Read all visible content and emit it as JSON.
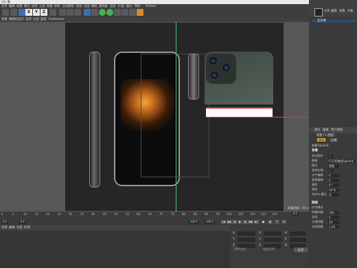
{
  "window": {
    "title": "(大) 墨"
  },
  "menubar": [
    "文件",
    "编辑",
    "创建",
    "模式",
    "选择",
    "工具",
    "网格",
    "体积",
    "运动图形",
    "角色",
    "动画",
    "模拟",
    "跟踪器",
    "渲染",
    "扩展",
    "窗口",
    "帮助",
    "Octane"
  ],
  "toolbar": {
    "axis_x": "X",
    "axis_y": "Y",
    "axis_z": "Z"
  },
  "view_menu": [
    "查看",
    "摄像机",
    "显示",
    "选项",
    "过滤",
    "面板",
    "ProRender"
  ],
  "viewport": {
    "grid_label": "网格间距 : 10 cm"
  },
  "timeline": {
    "ticks": [
      "0",
      "5",
      "10",
      "15",
      "20",
      "25",
      "30",
      "35",
      "40",
      "45",
      "50",
      "55",
      "60",
      "65",
      "70",
      "75",
      "80",
      "85",
      "90",
      "95",
      "100",
      "105",
      "110",
      "115",
      "120"
    ],
    "current_frame": "0 F",
    "start_field": "0 F",
    "end_field": "125 F",
    "end_field2": "125 F",
    "right_field": "0 F"
  },
  "bottom_tabs": [
    "创建",
    "编辑",
    "功能",
    "纹理"
  ],
  "coords": {
    "rows": [
      {
        "a": "X",
        "b": "X",
        "c": "H"
      },
      {
        "a": "Y",
        "b": "Y",
        "c": "P"
      },
      {
        "a": "Z",
        "b": "Z",
        "c": "B"
      }
    ],
    "mode1": "世界坐标",
    "mode2": "缩放比例",
    "apply": "应用"
  },
  "right_panel": {
    "top_menu": [
      "文件",
      "编辑",
      "查看",
      "对象"
    ],
    "object_name": "立方体",
    "attr_menu": [
      "模式",
      "编辑",
      "用户数据"
    ],
    "attr_title": "视窗 [1 视图]",
    "tabs": [
      {
        "label": "基本",
        "selected": true
      },
      {
        "label": "过滤",
        "selected": false
      }
    ],
    "tab2_label": "视图",
    "line_label": "查看OpenGL",
    "section1": "背景",
    "props": [
      {
        "k": "显示图片",
        "v": "✓"
      },
      {
        "k": "图像",
        "v": "F:\\C4D教程\\iphone"
      },
      {
        "k": "模式",
        "v": "视图"
      },
      {
        "k": "保持比例",
        "v": "✓"
      },
      {
        "k": "水平偏移",
        "v": "0"
      },
      {
        "k": "垂直偏移",
        "v": "0"
      },
      {
        "k": "旋转",
        "v": "0 °"
      },
      {
        "k": "透明",
        "v": "34 %"
      },
      {
        "k": "Alpha 模式",
        "v": "无"
      }
    ],
    "section2": "网格",
    "props2": [
      {
        "k": "作为模式",
        "v": ""
      },
      {
        "k": "网格间隔",
        "v": "100"
      },
      {
        "k": "次线",
        "v": "5"
      },
      {
        "k": "主线间隔",
        "v": "10"
      },
      {
        "k": "动态网格",
        "v": "1.20"
      }
    ]
  }
}
